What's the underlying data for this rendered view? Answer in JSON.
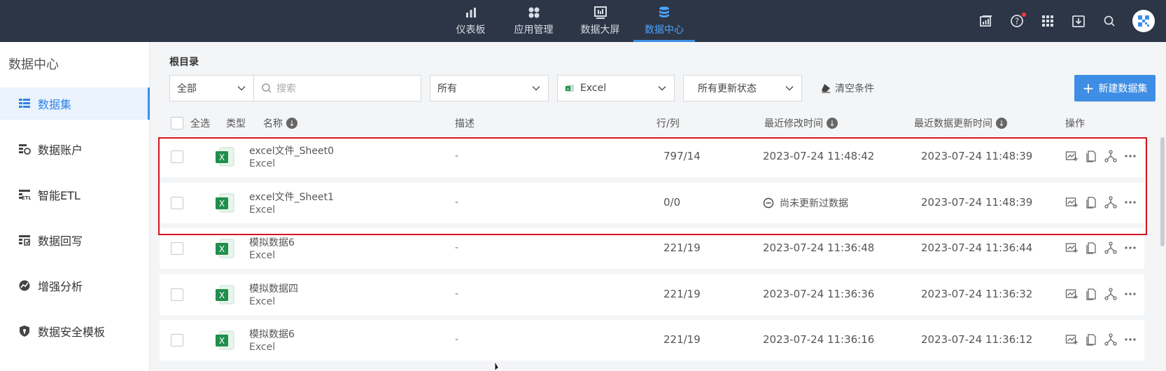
{
  "topnav": {
    "items": [
      {
        "label": "仪表板",
        "icon": "bar-chart-icon"
      },
      {
        "label": "应用管理",
        "icon": "apps-icon"
      },
      {
        "label": "数据大屏",
        "icon": "screen-icon"
      },
      {
        "label": "数据中心",
        "icon": "database-icon"
      }
    ],
    "active_index": 3
  },
  "sidebar": {
    "title": "数据中心",
    "items": [
      {
        "label": "数据集",
        "icon": "dataset-icon"
      },
      {
        "label": "数据账户",
        "icon": "account-icon"
      },
      {
        "label": "智能ETL",
        "icon": "etl-icon"
      },
      {
        "label": "数据回写",
        "icon": "writeback-icon"
      },
      {
        "label": "增强分析",
        "icon": "analysis-icon"
      },
      {
        "label": "数据安全模板",
        "icon": "shield-icon"
      }
    ],
    "active_index": 0
  },
  "breadcrumb": "根目录",
  "filters": {
    "scope": "全部",
    "search_placeholder": "搜索",
    "owner": "所有",
    "source": "Excel",
    "update_status": "所有更新状态",
    "clear_label": "清空条件",
    "new_label": "新建数据集"
  },
  "table": {
    "headers": {
      "select_all": "全选",
      "type": "类型",
      "name": "名称",
      "desc": "描述",
      "rows_cols": "行/列",
      "modified": "最近修改时间",
      "updated": "最近数据更新时间",
      "ops": "操作"
    },
    "rows": [
      {
        "name": "excel文件_Sheet0",
        "type": "Excel",
        "desc": "-",
        "rows_cols": "797/14",
        "modified": "2023-07-24 11:48:42",
        "updated": "2023-07-24 11:48:39",
        "never_updated": false
      },
      {
        "name": "excel文件_Sheet1",
        "type": "Excel",
        "desc": "-",
        "rows_cols": "0/0",
        "modified": "尚未更新过数据",
        "updated": "2023-07-24 11:48:39",
        "never_updated": true
      },
      {
        "name": "模拟数据6",
        "type": "Excel",
        "desc": "-",
        "rows_cols": "221/19",
        "modified": "2023-07-24 11:36:48",
        "updated": "2023-07-24 11:36:44",
        "never_updated": false
      },
      {
        "name": "模拟数据四",
        "type": "Excel",
        "desc": "-",
        "rows_cols": "221/19",
        "modified": "2023-07-24 11:36:36",
        "updated": "2023-07-24 11:36:32",
        "never_updated": false
      },
      {
        "name": "模拟数据6",
        "type": "Excel",
        "desc": "-",
        "rows_cols": "221/19",
        "modified": "2023-07-24 11:36:16",
        "updated": "2023-07-24 11:36:12",
        "never_updated": false
      }
    ]
  },
  "colors": {
    "topbar": "#2d3646",
    "accent": "#3d8ee8",
    "highlight": "#d4141e",
    "excel_green": "#1f8f4e"
  }
}
